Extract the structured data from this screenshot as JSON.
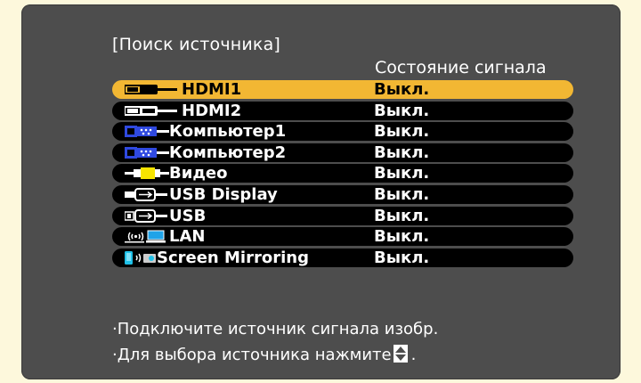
{
  "dialog": {
    "title": "[Поиск источника]",
    "status_header": "Состояние сигнала"
  },
  "sources": [
    {
      "name": "HDMI1",
      "status": "Выкл.",
      "icon": "hdmi-icon",
      "selected": true
    },
    {
      "name": "HDMI2",
      "status": "Выкл.",
      "icon": "hdmi-icon",
      "selected": false
    },
    {
      "name": "Компьютер1",
      "status": "Выкл.",
      "icon": "vga-computer-icon",
      "selected": false
    },
    {
      "name": "Компьютер2",
      "status": "Выкл.",
      "icon": "vga-computer-icon",
      "selected": false
    },
    {
      "name": "Видео",
      "status": "Выкл.",
      "icon": "rca-video-icon",
      "selected": false
    },
    {
      "name": "USB Display",
      "status": "Выкл.",
      "icon": "usb-display-icon",
      "selected": false
    },
    {
      "name": "USB",
      "status": "Выкл.",
      "icon": "usb-icon",
      "selected": false
    },
    {
      "name": "LAN",
      "status": "Выкл.",
      "icon": "lan-wireless-icon",
      "selected": false
    },
    {
      "name": "Screen Mirroring",
      "status": "Выкл.",
      "icon": "screen-mirroring-icon",
      "selected": false
    }
  ],
  "instructions": {
    "line1": "·Подключите источник сигнала изобр.",
    "line2_prefix": "·Для выбора источника нажмите",
    "line2_icon": "up-down-arrow-icon",
    "line2_suffix": "."
  },
  "colors": {
    "panel": "#4d4d4d",
    "selected": "#f2b733",
    "row": "#000000",
    "vga_blue": "#2f49e0",
    "video_yellow": "#f7e400",
    "mirroring_cyan": "#1fc1e8"
  }
}
